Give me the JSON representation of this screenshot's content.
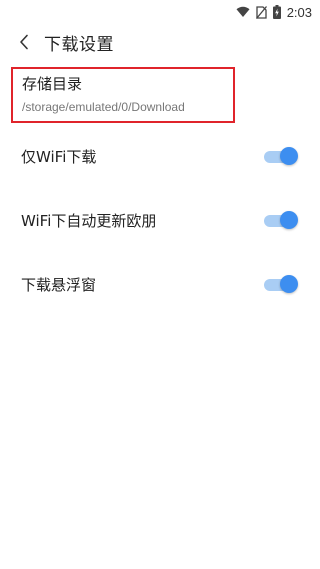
{
  "status_bar": {
    "time": "2:03",
    "icons": [
      "wifi-icon",
      "no-sim-icon",
      "battery-charging-icon"
    ]
  },
  "header": {
    "title": "下载设置",
    "back_icon": "chevron-left-icon"
  },
  "storage": {
    "label": "存储目录",
    "path": "/storage/emulated/0/Download",
    "highlight_color": "#e0242b"
  },
  "settings": [
    {
      "label": "仅WiFi下载",
      "enabled": true
    },
    {
      "label": "WiFi下自动更新欧朋",
      "enabled": true
    },
    {
      "label": "下载悬浮窗",
      "enabled": true
    }
  ],
  "colors": {
    "toggle_on_thumb": "#3d8ef0",
    "toggle_on_track": "#a9cdf4"
  }
}
